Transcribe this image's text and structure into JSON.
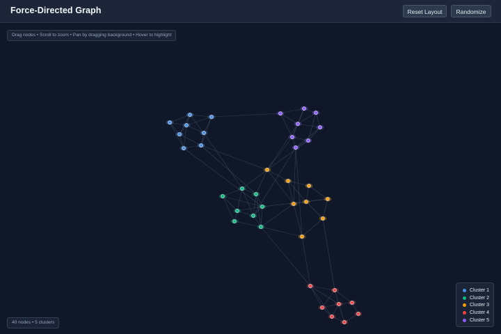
{
  "header": {
    "title": "Force-Directed Graph",
    "buttons": {
      "reset": "Reset Layout",
      "randomize": "Randomize"
    }
  },
  "hint": "Drag nodes • Scroll to zoom • Pan by dragging background • Hover to highlight",
  "stats": "40 nodes • 5 clusters",
  "legend": [
    {
      "label": "Cluster 1",
      "color": "#4a90e2"
    },
    {
      "label": "Cluster 2",
      "color": "#10b981"
    },
    {
      "label": "Cluster 3",
      "color": "#f59e0b"
    },
    {
      "label": "Cluster 4",
      "color": "#ef4444"
    },
    {
      "label": "Cluster 5",
      "color": "#8b5cf6"
    }
  ]
}
